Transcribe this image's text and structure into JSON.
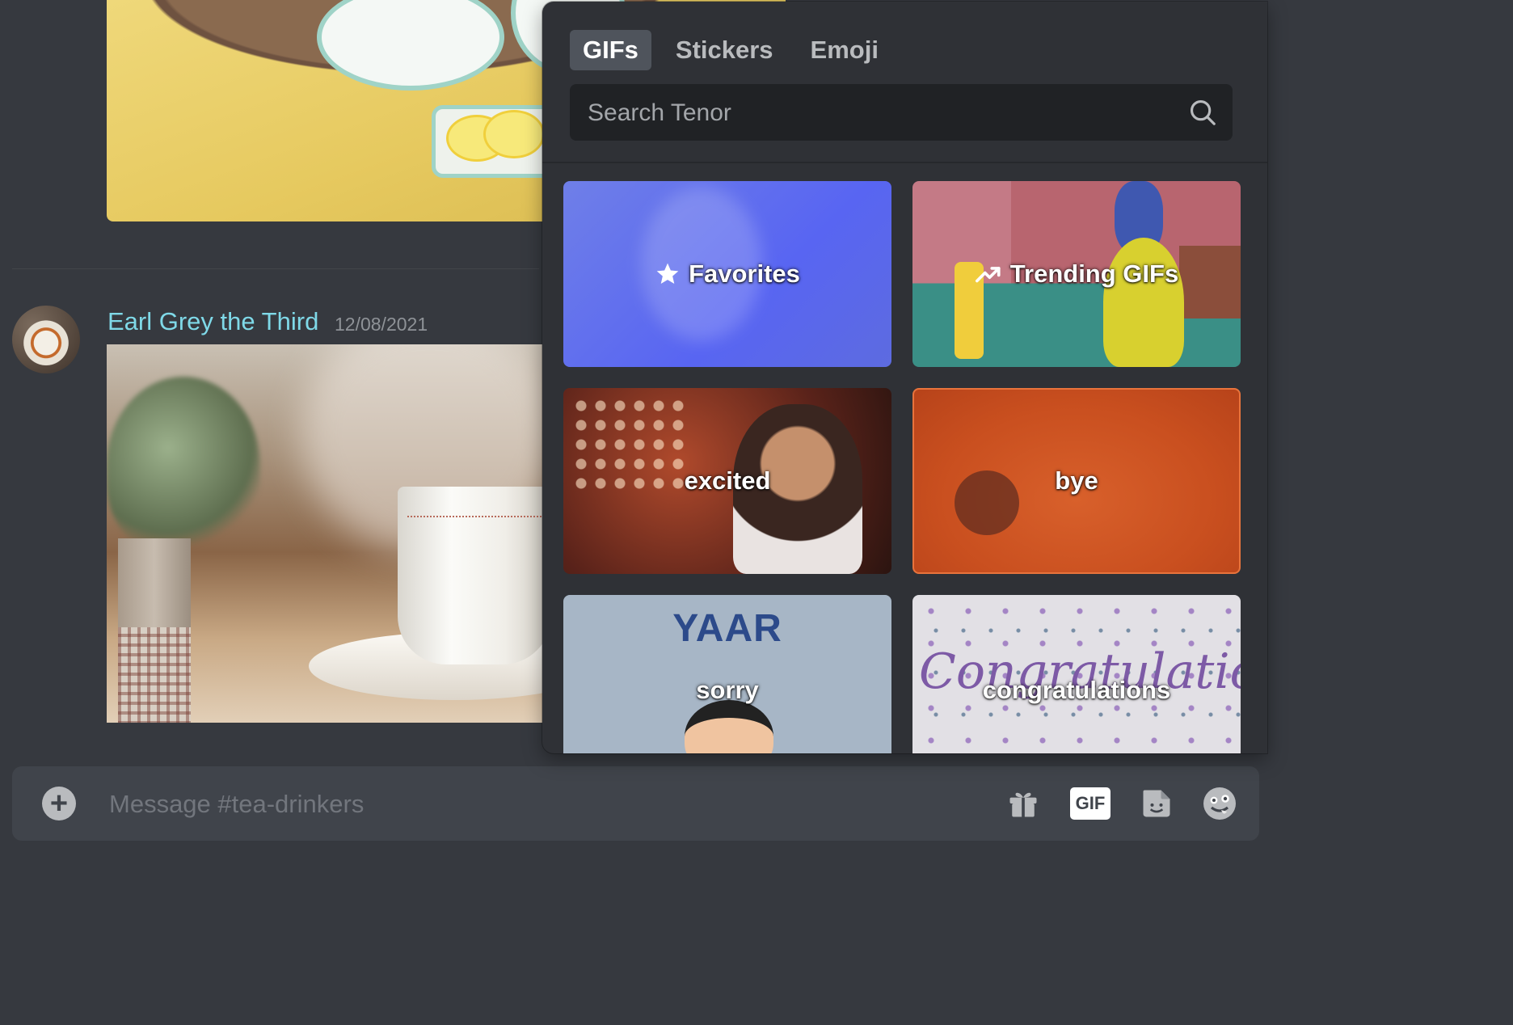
{
  "message": {
    "author": "Earl Grey the Third",
    "timestamp": "12/08/2021"
  },
  "composer": {
    "placeholder": "Message #tea-drinkers",
    "gif_label": "GIF"
  },
  "picker": {
    "tabs": [
      "GIFs",
      "Stickers",
      "Emoji"
    ],
    "active_tab": "GIFs",
    "search_placeholder": "Search Tenor",
    "categories": [
      "Favorites",
      "Trending GIFs",
      "excited",
      "bye",
      "sorry",
      "congratulations"
    ],
    "tile_texts": {
      "sorry_overlay": "YAAR",
      "congrats_overlay": "Congratulations!"
    }
  },
  "colors": {
    "username": "#7fd9e8",
    "background": "#36393f",
    "picker_bg": "#2f3136",
    "favorites_tile": "#5865f2"
  },
  "icons": {
    "favorites": "star-icon",
    "trending": "trending-up-icon",
    "search": "search-icon",
    "attach": "plus-circle-icon",
    "gift": "gift-icon",
    "sticker": "sticker-icon",
    "emoji": "emoji-icon"
  }
}
